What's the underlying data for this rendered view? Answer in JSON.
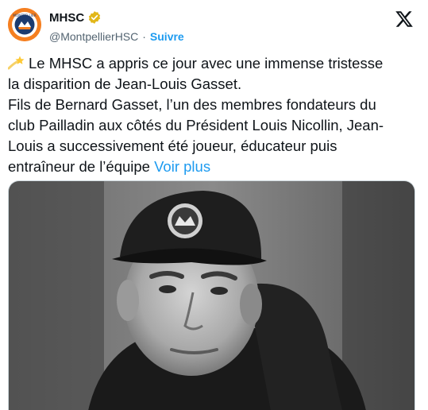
{
  "account": {
    "name": "MHSC",
    "handle": "@MontpellierHSC",
    "separator": "·",
    "follow_label": "Suivre",
    "avatar_icon": "club-crest-icon",
    "verified_icon": "gold-verified-badge-icon",
    "avatar_color": "#f57f20",
    "verified_color": "#e2b719"
  },
  "platform": {
    "logo_icon": "x-logo-icon"
  },
  "tweet": {
    "emoji_icon": "shooting-star-emoji-icon",
    "body": "Le MHSC a appris ce jour avec une immense tristesse\nla disparition de Jean-Louis Gasset.\nFils de Bernard Gasset, l’un des membres fondateurs du\nclub Pailladin aux côtés du Président Louis Nicollin, Jean-\nLouis a successivement été joueur, éducateur puis\nentraîneur de l’équipe ",
    "see_more_label": "Voir plus",
    "link_color": "#1d9bf0"
  },
  "media": {
    "type": "black-and-white-portrait-photo"
  }
}
